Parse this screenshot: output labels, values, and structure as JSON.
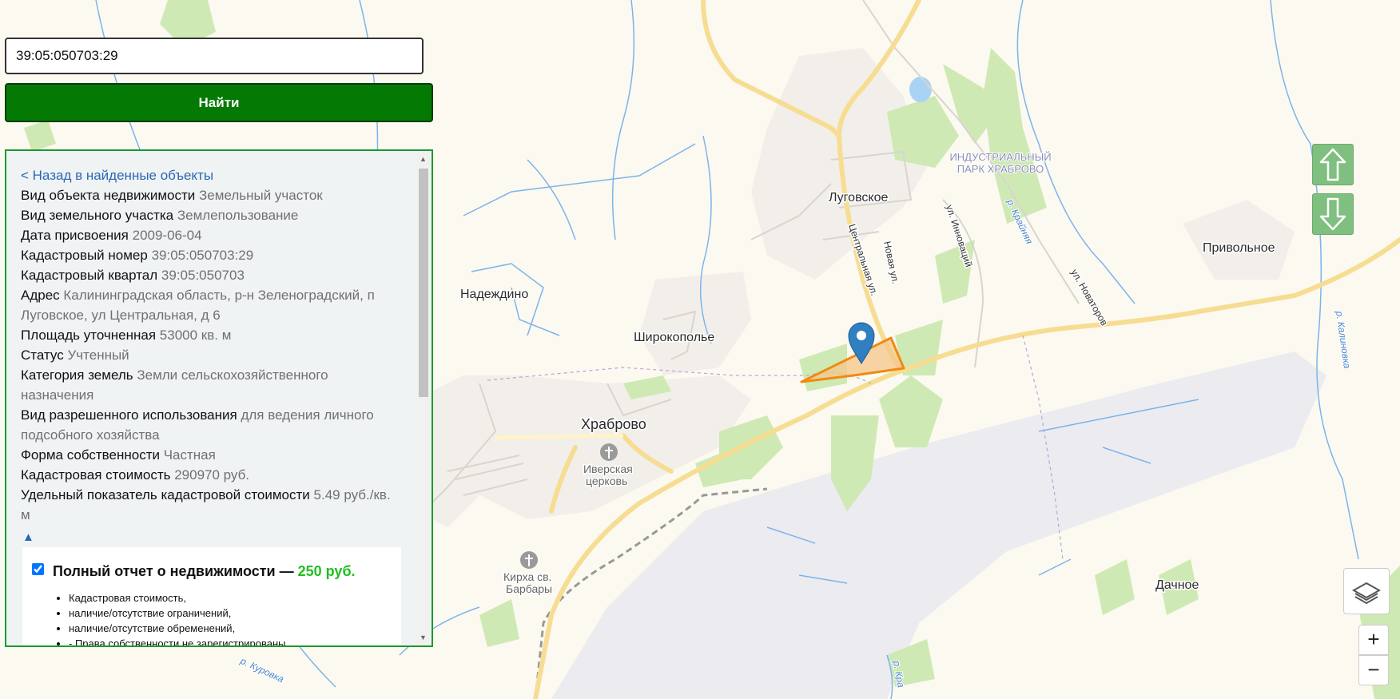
{
  "search": {
    "value": "39:05:050703:29",
    "button_label": "Найти"
  },
  "info": {
    "back_link": "< Назад в найденные объекты",
    "props": [
      {
        "label": "Вид объекта недвижимости",
        "value": "Земельный участок"
      },
      {
        "label": "Вид земельного участка",
        "value": "Землепользование"
      },
      {
        "label": "Дата присвоения",
        "value": "2009-06-04"
      },
      {
        "label": "Кадастровый номер",
        "value": "39:05:050703:29"
      },
      {
        "label": "Кадастровый квартал",
        "value": "39:05:050703"
      },
      {
        "label": "Адрес",
        "value": "Калининградская область, р-н Зеленоградский, п Луговское, ул Центральная, д 6"
      },
      {
        "label": "Площадь уточненная",
        "value": "53000 кв. м"
      },
      {
        "label": "Статус",
        "value": "Учтенный"
      },
      {
        "label": "Категория земель",
        "value": "Земли сельскохозяйственного назначения"
      },
      {
        "label": "Вид разрешенного использования",
        "value": "для ведения личного подсобного хозяйства"
      },
      {
        "label": "Форма собственности",
        "value": "Частная"
      },
      {
        "label": "Кадастровая стоимость",
        "value": "290970 руб."
      },
      {
        "label": "Удельный показатель кадастровой стоимости",
        "value": "5.49 руб./кв. м"
      }
    ],
    "collapse_symbol": "▲"
  },
  "report": {
    "checked": true,
    "title": "Полный отчет о недвижимости —",
    "price": "250 руб.",
    "items": [
      "Кадастровая стоимость,",
      "наличие/отсутствие ограничений,",
      "наличие/отсутствие обременений,",
      "- Права собственности не зарегистрированы"
    ]
  },
  "map": {
    "places": {
      "lugovskoe": "Луговское",
      "nadezhdino": "Надеждино",
      "shirokopolye": "Широкополье",
      "khrabrovo": "Храброво",
      "privolnoe": "Привольное",
      "dachnoe": "Дачное"
    },
    "streets": {
      "centralnaya": "Центральная ул.",
      "novaya": "Новая ул.",
      "innovatsiy": "ул. Инноваций",
      "novatorov": "ул. Новаторов"
    },
    "rivers": {
      "krainyaya": "р. Крайняя",
      "kalinovka": "р. Калиновка",
      "kurovka": "р. Куровка",
      "krainyaya_south": "р. Кра"
    },
    "pois": {
      "iverskaya_1": "Иверская",
      "iverskaya_2": "церковь",
      "kirkha_1": "Кирха св.",
      "kirkha_2": "Барбары"
    },
    "zone": {
      "line1": "ИНДУСТРИАЛЬНЫЙ",
      "line2": "ПАРК ХРАБРОВО"
    }
  },
  "controls": {
    "zoom_in": "+",
    "zoom_out": "−"
  },
  "colors": {
    "search_button": "#047a04",
    "panel_border": "#1a9a2e",
    "link": "#2a67b3",
    "price": "#1fbf1f",
    "parcel_outline": "#f08a10",
    "marker": "#2f7fc1",
    "nav_buttons": "#7fbf7f"
  }
}
